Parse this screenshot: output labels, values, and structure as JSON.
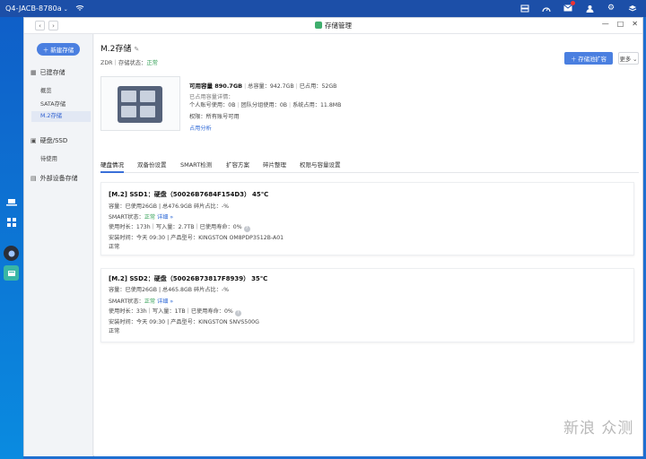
{
  "topbar": {
    "host": "Q4-JACB-8780a",
    "caret": "⌄",
    "wifi_icon": "wifi-icon",
    "right_icons": [
      "folders-icon",
      "gauge-icon",
      "mail-icon",
      "user-icon",
      "gear-icon",
      "layers-icon"
    ]
  },
  "window": {
    "title": "存储管理",
    "back": "‹",
    "forward": "›",
    "minimize": "—",
    "maximize": "□",
    "close": "✕"
  },
  "sidebar": {
    "new_button": "＋ 新建存储",
    "groups": [
      {
        "label": "已建存储",
        "items": [
          "概览",
          "SATA存储",
          "M.2存储"
        ]
      },
      {
        "label": "硬盘/SSD",
        "items": [
          "待使用"
        ]
      },
      {
        "label": "外部设备存储",
        "items": []
      }
    ],
    "active_item": "M.2存储"
  },
  "header": {
    "title": "M.2存储",
    "edit_icon": "✎",
    "subtitle_prefix": "ZDR｜存储状态：",
    "status": "正常",
    "expand_button": "＋ 存储池扩容",
    "more_button": "更多 ⌄"
  },
  "capacity": {
    "available": "可用容量 890.7GB",
    "total": "总容量：942.7GB",
    "used": "已占用：52GB",
    "detail_title": "已占用容量详情：",
    "personal": "个人账号使用：0B",
    "team": "团队分组使用：0B",
    "system": "系统占用：11.8MB",
    "permission": "权限：所有账号可用",
    "analysis_link": "占用分析"
  },
  "tabs": [
    "硬盘情况",
    "双备份设置",
    "SMART检测",
    "扩容方案",
    "碎片整理",
    "权限与容量设置"
  ],
  "disks": [
    {
      "title": "[M.2] SSD1：硬盘（50026B7684F154D3）",
      "temp": "45℃",
      "capacity": "容量：已使用26GB | 总476.9GB   碎片占比：-%",
      "smart_label": "SMART状态：",
      "smart_status": "正常",
      "detail_link": "详细 »",
      "usage": "使用时长：173h｜写入量：2.7TB｜已使用寿命：0%",
      "install": "安装时间：今天 09:30 | 产品型号：KINGSTON OM8PDP3512B-A01",
      "status": "正常"
    },
    {
      "title": "[M.2] SSD2：硬盘（50026B73817F8939）",
      "temp": "35℃",
      "capacity": "容量：已使用26GB | 总465.8GB   碎片占比：-%",
      "smart_label": "SMART状态：",
      "smart_status": "正常",
      "detail_link": "详细 »",
      "usage": "使用时长：33h｜写入量：1TB｜已使用寿命：0%",
      "install": "安装时间：今天 09:30 | 产品型号：KINGSTON SNVS500G",
      "status": "正常"
    }
  ],
  "watermark": "新浪 众测",
  "colors": {
    "accent": "#4a7fe0",
    "ok": "#3aa35b",
    "topbar": "#1c4fa8"
  }
}
